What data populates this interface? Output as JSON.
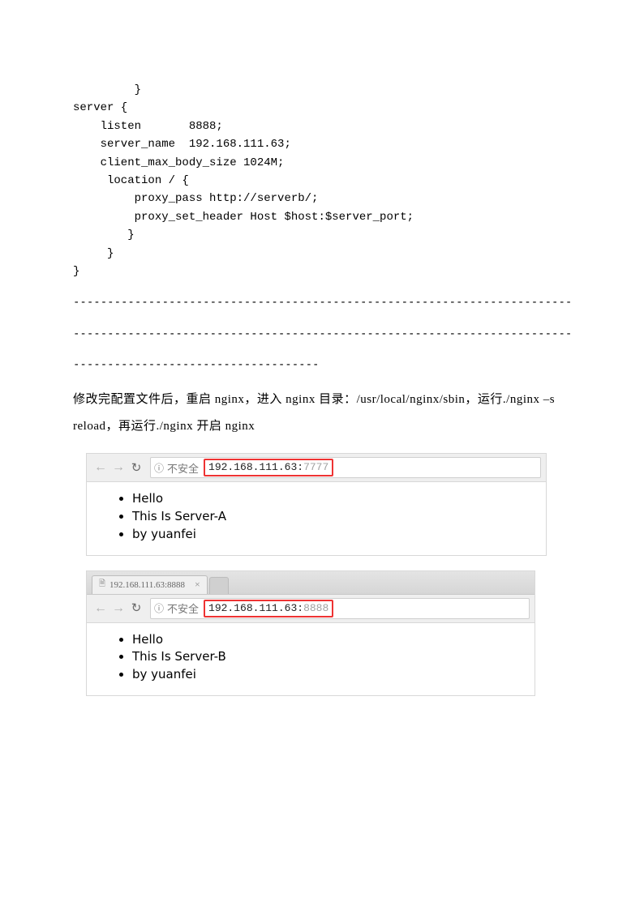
{
  "code_block": "         }\nserver {\n    listen       8888;\n    server_name  192.168.111.63;\n    client_max_body_size 1024M;\n     location / {\n         proxy_pass http://serverb/;\n         proxy_set_header Host $host:$server_port;\n        }\n     }\n}",
  "separator_long": "---------------------------------------------------------------------------------------",
  "separator_short": "------------------------------------",
  "paragraph_text": "修改完配置文件后，重启 nginx，进入 nginx 目录：/usr/local/nginx/sbin，运行./nginx –s reload，再运行./nginx 开启 nginx",
  "screenshot1": {
    "nav": {
      "back": "←",
      "forward": "→",
      "reload": "↻"
    },
    "addrbar": {
      "info_icon": "ⓘ",
      "insecure_label": "不安全",
      "url_host": "192.168.111.63:",
      "url_port": "7777"
    },
    "body_items": [
      "Hello",
      "This Is Server-A",
      "by yuanfei"
    ]
  },
  "screenshot2": {
    "tab": {
      "page_icon": "🗎",
      "title": "192.168.111.63:8888",
      "close": "×"
    },
    "nav": {
      "back": "←",
      "forward": "→",
      "reload": "↻"
    },
    "addrbar": {
      "info_icon": "ⓘ",
      "insecure_label": "不安全",
      "url_host": "192.168.111.63:",
      "url_port": "8888"
    },
    "body_items": [
      "Hello",
      "This Is Server-B",
      "by yuanfei"
    ]
  }
}
